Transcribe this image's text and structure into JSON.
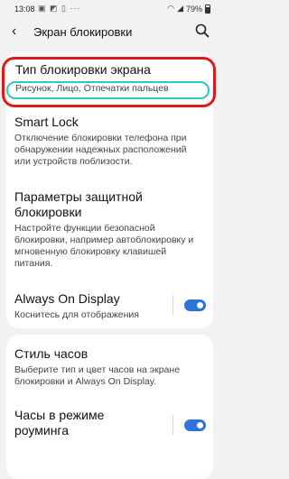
{
  "status": {
    "time": "13:08",
    "battery": "79%"
  },
  "header": {
    "title": "Экран блокировки"
  },
  "items": [
    {
      "title": "Тип блокировки экрана",
      "subtitle": "Рисунок, Лицо, Отпечатки пальцев"
    },
    {
      "title": "Smart Lock",
      "subtitle": "Отключение блокировки телефона при обнаружении надежных расположений или устройств поблизости."
    },
    {
      "title": "Параметры защитной блокировки",
      "subtitle": "Настройте функции безопасной блокировки, например автоблокировку и мгновенную блокировку клавишей питания."
    },
    {
      "title": "Always On Display",
      "subtitle": "Коснитесь для отображения",
      "toggle_on": true
    },
    {
      "title": "Стиль часов",
      "subtitle": "Выберите тип и цвет часов на экране блокировки и Always On Display."
    },
    {
      "title": "Часы в режиме роуминга",
      "toggle_on": true
    }
  ],
  "colors": {
    "accent": "#2f72d8",
    "highlight_red": "#e01818",
    "highlight_teal": "#34c7bf",
    "background": "#f2f2f2"
  },
  "icons": [
    "back-arrow-icon",
    "search-icon"
  ]
}
